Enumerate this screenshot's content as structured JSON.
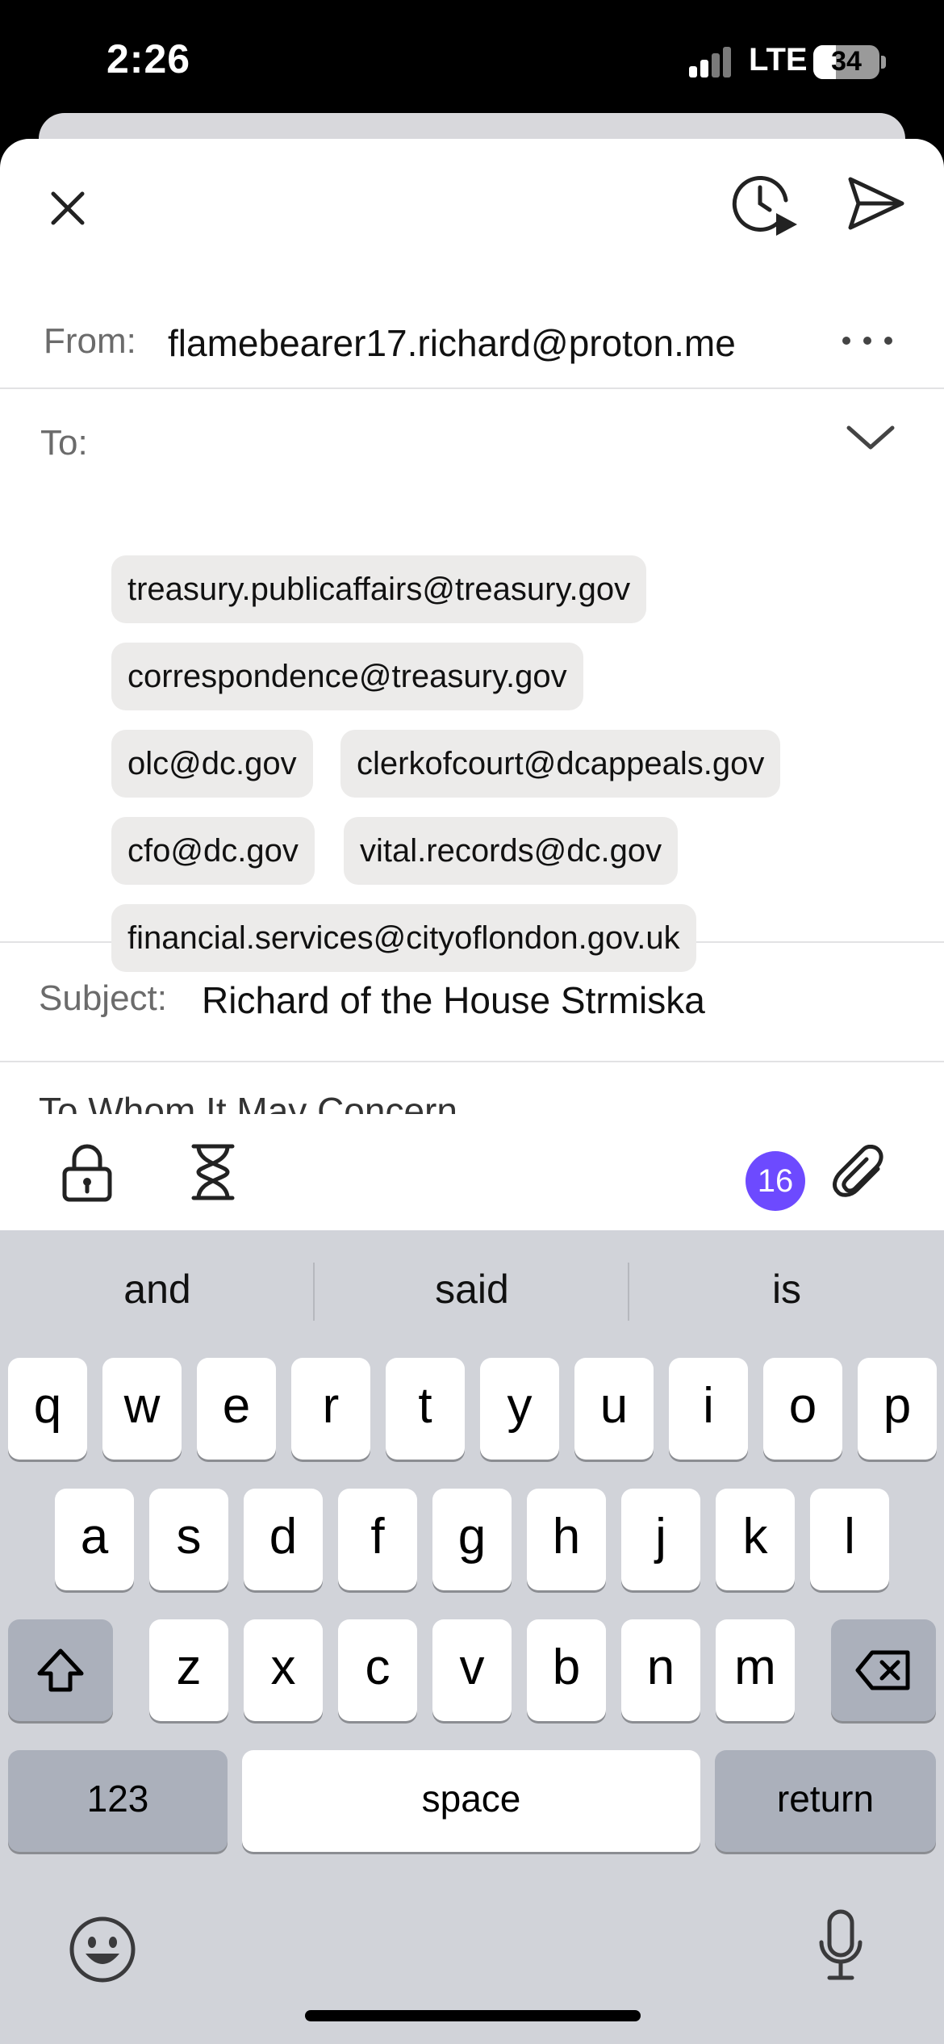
{
  "status_bar": {
    "time": "2:26",
    "network": "LTE",
    "battery": "34",
    "battery_level": 0.34
  },
  "toolbar": {
    "close_icon": "close-icon",
    "schedule_icon": "schedule-send-icon",
    "send_icon": "send-icon"
  },
  "from": {
    "label": "From:",
    "value": "flamebearer17.richard@proton.me"
  },
  "to": {
    "label": "To:",
    "recipients": [
      "treasury.publicaffairs@treasury.gov",
      "correspondence@treasury.gov",
      "olc@dc.gov",
      "clerkofcourt@dcappeals.gov",
      "cfo@dc.gov",
      "vital.records@dc.gov",
      "financial.services@cityoflondon.gov.uk"
    ]
  },
  "subject": {
    "label": "Subject:",
    "value": "Richard of the House Strmiska"
  },
  "body": {
    "first_line": "To Whom It May Concern"
  },
  "compose_tools": {
    "attachment_count": "16",
    "accent_color": "#6d4aff"
  },
  "keyboard": {
    "suggestions": [
      "and",
      "said",
      "is"
    ],
    "row1": [
      "q",
      "w",
      "e",
      "r",
      "t",
      "y",
      "u",
      "i",
      "o",
      "p"
    ],
    "row2": [
      "a",
      "s",
      "d",
      "f",
      "g",
      "h",
      "j",
      "k",
      "l"
    ],
    "row3": [
      "z",
      "x",
      "c",
      "v",
      "b",
      "n",
      "m"
    ],
    "numbers_label": "123",
    "space_label": "space",
    "return_label": "return"
  }
}
